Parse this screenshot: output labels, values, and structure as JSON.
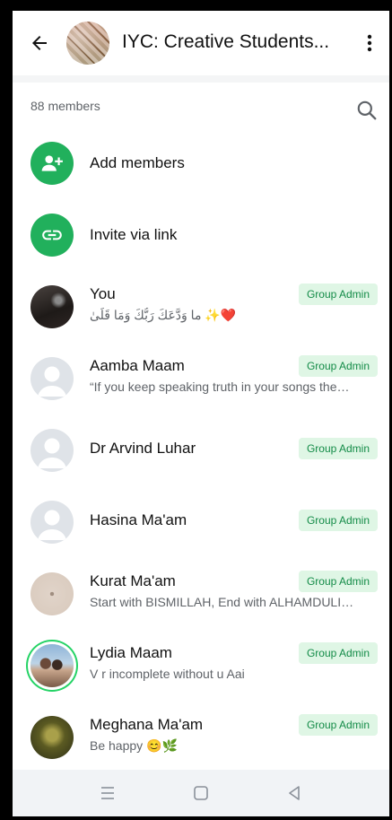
{
  "header": {
    "title": "IYC: Creative Students..."
  },
  "members_count": "88 members",
  "actions": [
    {
      "label": "Add members",
      "icon": "add-person-icon"
    },
    {
      "label": "Invite via link",
      "icon": "link-icon"
    }
  ],
  "members": [
    {
      "name": "You",
      "status": "ما وَدَّعَكَ رَبُّكَ وَمَا قَلَىٰ ✨❤️",
      "badge": "Group Admin"
    },
    {
      "name": "Aamba Maam",
      "status": "“If you keep speaking truth in your songs the…",
      "badge": "Group Admin"
    },
    {
      "name": "Dr Arvind Luhar",
      "status": "",
      "badge": "Group Admin"
    },
    {
      "name": "Hasina Ma'am",
      "status": "",
      "badge": "Group Admin"
    },
    {
      "name": "Kurat Ma'am",
      "status": "Start with BISMILLAH, End with ALHAMDULI…",
      "badge": "Group Admin"
    },
    {
      "name": "Lydia Maam",
      "status": "V r incomplete without u Aai",
      "badge": "Group Admin"
    },
    {
      "name": "Meghana Ma'am",
      "status": "Be happy 😊🌿",
      "badge": "Group Admin"
    }
  ],
  "colors": {
    "accent_green": "#21b05c",
    "badge_bg": "#dff6e5",
    "badge_text": "#138b47"
  }
}
